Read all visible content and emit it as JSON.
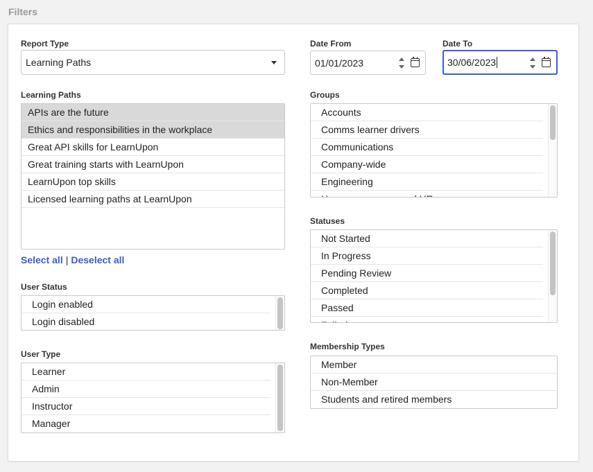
{
  "section_title": "Filters",
  "report_type": {
    "label": "Report Type",
    "value": "Learning Paths"
  },
  "date_from": {
    "label": "Date From",
    "value": "01/01/2023"
  },
  "date_to": {
    "label": "Date To",
    "value": "30/06/2023"
  },
  "learning_paths": {
    "label": "Learning Paths",
    "items": [
      {
        "label": "APIs are the future",
        "selected": true
      },
      {
        "label": "Ethics and responsibilities in the workplace",
        "selected": true
      },
      {
        "label": "Great API skills for LearnUpon",
        "selected": false
      },
      {
        "label": "Great training starts with LearnUpon",
        "selected": false
      },
      {
        "label": "LearnUpon top skills",
        "selected": false
      },
      {
        "label": "Licensed learning paths at LearnUpon",
        "selected": false
      }
    ],
    "select_all": "Select all",
    "separator": "|",
    "deselect_all": "Deselect all"
  },
  "user_status": {
    "label": "User Status",
    "items": [
      "Login enabled",
      "Login disabled"
    ]
  },
  "user_type": {
    "label": "User Type",
    "items": [
      "Learner",
      "Admin",
      "Instructor",
      "Manager"
    ]
  },
  "groups": {
    "label": "Groups",
    "items": [
      "Accounts",
      "Comms learner drivers",
      "Communications",
      "Company-wide",
      "Engineering",
      "Human resources and HR"
    ]
  },
  "statuses": {
    "label": "Statuses",
    "items": [
      "Not Started",
      "In Progress",
      "Pending Review",
      "Completed",
      "Passed",
      "Failed"
    ]
  },
  "membership_types": {
    "label": "Membership Types",
    "items": [
      "Member",
      "Non-Member",
      "Students and retired members"
    ]
  },
  "colors": {
    "link": "#3a5bd6",
    "selected_row": "#d9d9d9",
    "focus_border": "#3a5bd6"
  }
}
